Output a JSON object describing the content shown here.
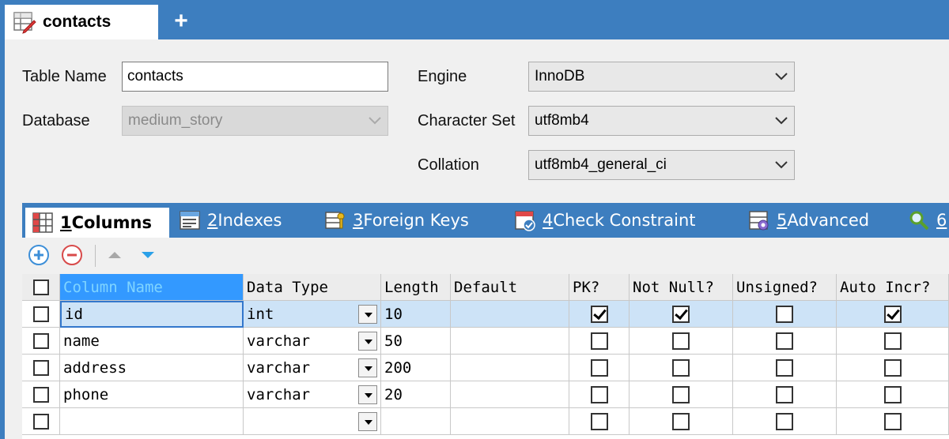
{
  "doc_tab": {
    "label": "contacts",
    "icon": "table-edit-icon",
    "add_label": "+"
  },
  "form": {
    "table_name_label": "Table Name",
    "table_name_value": "contacts",
    "database_label": "Database",
    "database_value": "medium_story",
    "engine_label": "Engine",
    "engine_value": "InnoDB",
    "charset_label": "Character Set",
    "charset_value": "utf8mb4",
    "collation_label": "Collation",
    "collation_value": "utf8mb4_general_ci"
  },
  "section_tabs": [
    {
      "num": "1",
      "label": " Columns",
      "icon": "columns-grid-icon"
    },
    {
      "num": "2",
      "label": " Indexes",
      "icon": "indexes-icon"
    },
    {
      "num": "3",
      "label": " Foreign Keys",
      "icon": "foreign-keys-icon"
    },
    {
      "num": "4",
      "label": " Check Constraint",
      "icon": "check-constraint-icon"
    },
    {
      "num": "5",
      "label": " Advanced",
      "icon": "advanced-settings-icon"
    },
    {
      "num": "6",
      "label": "",
      "icon": "search-icon"
    }
  ],
  "toolbar": {
    "add": "add-column-icon",
    "remove": "remove-column-icon",
    "up": "move-up-icon",
    "down": "move-down-icon"
  },
  "grid": {
    "headers": [
      "Column Name",
      "Data Type",
      "Length",
      "Default",
      "PK?",
      "Not Null?",
      "Unsigned?",
      "Auto Incr?"
    ],
    "rows": [
      {
        "name": "id",
        "type": "int",
        "length": "10",
        "default": "",
        "pk": true,
        "not_null": true,
        "unsigned": false,
        "auto_incr": true
      },
      {
        "name": "name",
        "type": "varchar",
        "length": "50",
        "default": "",
        "pk": false,
        "not_null": false,
        "unsigned": false,
        "auto_incr": false
      },
      {
        "name": "address",
        "type": "varchar",
        "length": "200",
        "default": "",
        "pk": false,
        "not_null": false,
        "unsigned": false,
        "auto_incr": false
      },
      {
        "name": "phone",
        "type": "varchar",
        "length": "20",
        "default": "",
        "pk": false,
        "not_null": false,
        "unsigned": false,
        "auto_incr": false
      },
      {
        "name": "",
        "type": "",
        "length": "",
        "default": "",
        "pk": false,
        "not_null": false,
        "unsigned": false,
        "auto_incr": false
      }
    ]
  },
  "colors": {
    "accent": "#3d7ebf",
    "selected_row": "#cde3f7",
    "selected_header": "#3399ff"
  }
}
